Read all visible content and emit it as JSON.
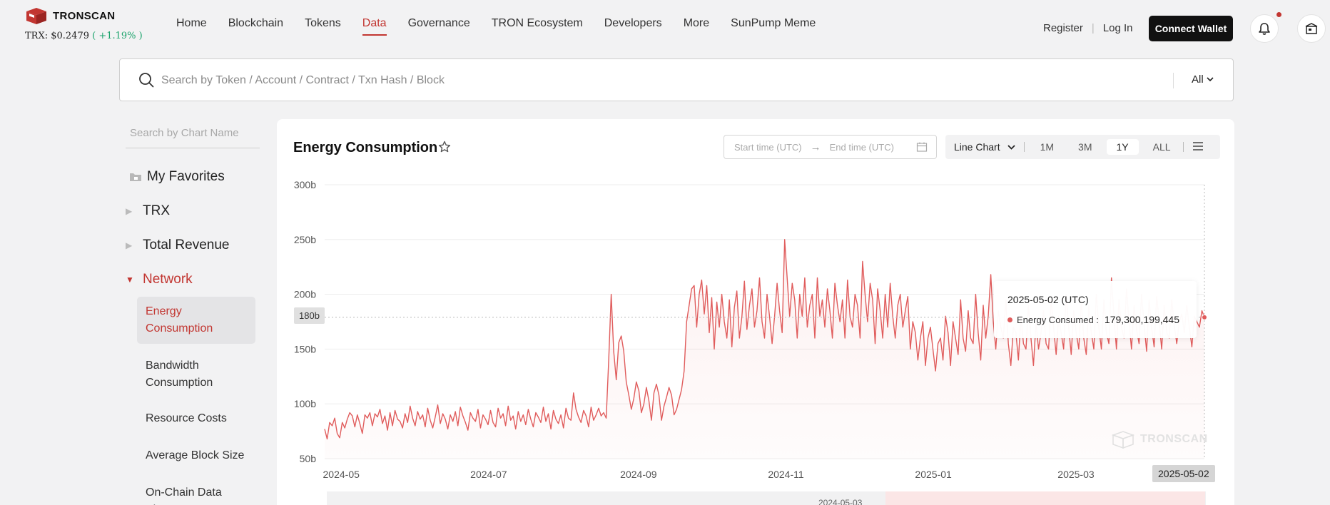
{
  "header": {
    "logo_text": "TRONSCAN",
    "price_label": "TRX:",
    "price_value": "$0.2479",
    "price_change": "( +1.19% )",
    "nav": [
      "Home",
      "Blockchain",
      "Tokens",
      "Data",
      "Governance",
      "TRON Ecosystem",
      "Developers",
      "More",
      "SunPump Meme"
    ],
    "active_nav": "Data",
    "register": "Register",
    "login": "Log In",
    "connect": "Connect Wallet",
    "accent": "#c23631"
  },
  "search": {
    "placeholder": "Search by Token / Account / Contract / Txn Hash / Block",
    "scope": "All"
  },
  "sidebar": {
    "chart_search_placeholder": "Search by Chart Name",
    "favorites": "My Favorites",
    "groups": [
      "TRX",
      "Total Revenue",
      "Network"
    ],
    "items": [
      "Energy Consumption",
      "Bandwidth Consumption",
      "Resource Costs",
      "Average Block Size",
      "On-Chain Data Size"
    ]
  },
  "chart": {
    "title": "Energy Consumption",
    "start_placeholder": "Start time (UTC)",
    "end_placeholder": "End time (UTC)",
    "chart_type": "Line Chart",
    "ranges": [
      "1M",
      "3M",
      "1Y",
      "ALL"
    ],
    "active_range": "1Y",
    "crosshair_y_label": "180b",
    "crosshair_x_label": "2025-05-02",
    "watermark": "TRONSCAN",
    "slider_label": "2024-05-03",
    "tooltip": {
      "date": "2025-05-02 (UTC)",
      "series": "Energy Consumed :",
      "value": "179,300,199,445"
    }
  },
  "chart_data": {
    "type": "line",
    "title": "Energy Consumption",
    "series_name": "Energy Consumed",
    "color": "#e05c5c",
    "x_range": [
      "2024-05-03",
      "2025-05-02"
    ],
    "x_ticks": [
      "2024-05",
      "2024-07",
      "2024-09",
      "2024-11",
      "2025-01",
      "2025-03"
    ],
    "y_ticks": [
      "50b",
      "100b",
      "150b",
      "200b",
      "250b",
      "300b"
    ],
    "ylim": [
      50,
      300
    ],
    "y_unit": "b",
    "values": [
      77,
      68,
      83,
      80,
      87,
      73,
      69,
      83,
      78,
      86,
      92,
      89,
      79,
      90,
      82,
      73,
      90,
      87,
      92,
      80,
      91,
      88,
      95,
      82,
      89,
      76,
      92,
      80,
      94,
      86,
      84,
      78,
      91,
      83,
      98,
      87,
      80,
      93,
      86,
      90,
      79,
      96,
      85,
      78,
      88,
      99,
      82,
      91,
      86,
      77,
      90,
      84,
      93,
      80,
      97,
      89,
      83,
      76,
      92,
      87,
      84,
      95,
      78,
      90,
      86,
      81,
      94,
      83,
      79,
      96,
      87,
      91,
      80,
      98,
      85,
      89,
      77,
      93,
      84,
      90,
      81,
      95,
      86,
      79,
      92,
      88,
      83,
      97,
      84,
      91,
      77,
      94,
      86,
      82,
      90,
      78,
      96,
      87,
      85,
      110,
      95,
      88,
      83,
      94,
      89,
      79,
      97,
      85,
      90,
      96,
      89,
      92,
      87,
      140,
      200,
      148,
      122,
      156,
      162,
      148,
      120,
      108,
      95,
      105,
      120,
      112,
      92,
      100,
      115,
      103,
      85,
      110,
      118,
      108,
      85,
      98,
      106,
      115,
      108,
      90,
      95,
      104,
      113,
      130,
      175,
      190,
      205,
      208,
      170,
      200,
      213,
      182,
      208,
      165,
      197,
      150,
      193,
      170,
      200,
      175,
      160,
      195,
      152,
      188,
      203,
      160,
      180,
      212,
      168,
      190,
      205,
      170,
      185,
      215,
      175,
      160,
      200,
      180,
      155,
      180,
      210,
      185,
      165,
      250,
      215,
      180,
      210,
      195,
      160,
      200,
      180,
      215,
      170,
      190,
      200,
      160,
      215,
      180,
      195,
      170,
      205,
      185,
      160,
      210,
      190,
      175,
      195,
      160,
      213,
      180,
      170,
      200,
      190,
      160,
      230,
      200,
      175,
      210,
      195,
      155,
      205,
      185,
      160,
      200,
      170,
      210,
      180,
      160,
      190,
      200,
      170,
      185,
      198,
      150,
      175,
      165,
      140,
      160,
      175,
      135,
      160,
      170,
      150,
      130,
      155,
      160,
      140,
      180,
      165,
      135,
      175,
      160,
      145,
      195,
      160,
      148,
      185,
      160,
      155,
      200,
      165,
      140,
      190,
      160,
      180,
      218,
      175,
      150,
      185,
      170,
      160,
      195,
      155,
      135,
      170,
      165,
      140,
      180,
      155,
      150,
      190,
      160,
      135,
      175,
      150,
      165,
      185,
      155,
      150,
      195,
      170,
      145,
      180,
      165,
      150,
      200,
      170,
      145,
      185,
      165,
      150,
      195,
      160,
      145,
      190,
      165,
      150,
      200,
      170,
      150,
      195,
      165,
      155,
      215,
      180,
      150,
      195,
      170,
      160,
      205,
      175,
      150,
      190,
      168,
      155,
      200,
      172,
      148,
      195,
      170,
      152,
      198,
      175,
      150,
      190,
      165,
      160,
      195,
      172,
      155,
      175,
      182,
      165,
      190,
      170,
      152,
      180,
      175,
      170,
      185,
      179
    ]
  }
}
